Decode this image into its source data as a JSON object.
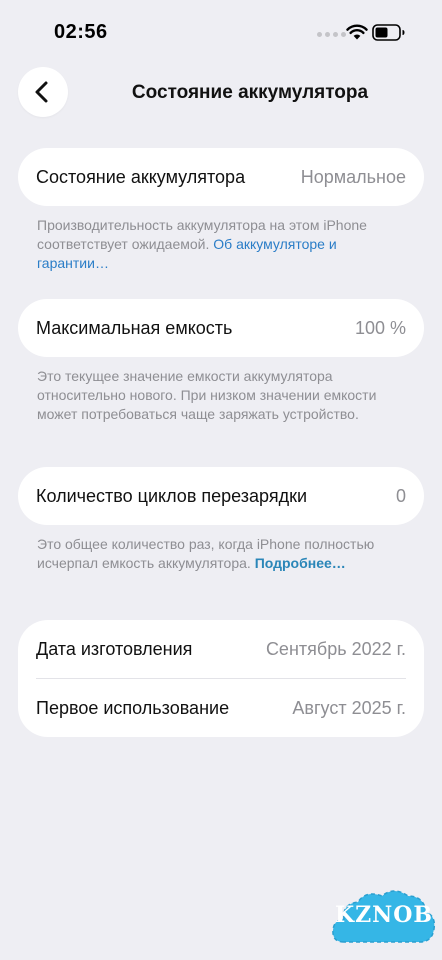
{
  "status_bar": {
    "time": "02:56"
  },
  "nav": {
    "title": "Состояние аккумулятора"
  },
  "battery_health": {
    "label": "Состояние аккумулятора",
    "value": "Нормальное",
    "footnote_text": "Производительность аккумулятора на этом iPhone соответствует ожидаемой.",
    "footnote_link": "Об аккумуляторе и гарантии…"
  },
  "max_capacity": {
    "label": "Максимальная емкость",
    "value": "100 %",
    "footnote_text": "Это текущее значение емкости аккумулятора относительно нового. При низком значении емкости может потребоваться чаще заряжать устройство."
  },
  "cycle_count": {
    "label": "Количество циклов перезарядки",
    "value": "0",
    "footnote_text": "Это общее количество раз, когда iPhone полностью исчерпал емкость аккумулятора.",
    "footnote_link": "Подробнее…"
  },
  "dates": {
    "manufacture_label": "Дата изготовления",
    "manufacture_value": "Сентябрь 2022 г.",
    "first_use_label": "Первое использование",
    "first_use_value": "Август 2025 г."
  },
  "watermark": {
    "text": "KZNOB"
  },
  "colors": {
    "background": "#eeeef3",
    "card": "#ffffff",
    "secondary_text": "#8e8e93",
    "link": "#2a7dc7",
    "watermark": "#35b6e6"
  },
  "icons": {
    "back": "chevron-left-icon",
    "wifi": "wifi-icon",
    "battery": "battery-icon"
  }
}
